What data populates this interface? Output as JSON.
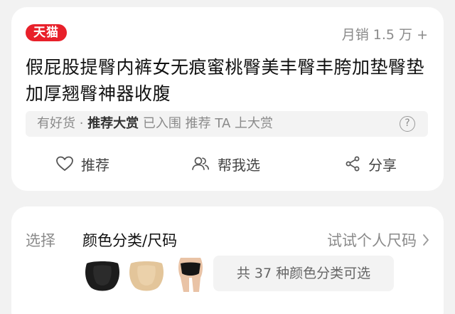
{
  "product": {
    "badge": "天猫",
    "sales": "月销 1.5 万 +",
    "title": "假屁股提臀内裤女无痕蜜桃臀美丰臀丰胯加垫臀垫加厚翘臀神器收腹",
    "award": {
      "prefix": "有好货 ·",
      "highlight": "推荐大赏",
      "suffix": "已入围 推荐 TA 上大赏",
      "help_glyph": "?"
    }
  },
  "actions": {
    "recommend": "推荐",
    "help_choose": "帮我选",
    "share": "分享"
  },
  "selection": {
    "label": "选择",
    "value": "颜色分类/尺码",
    "size_link": "试试个人尺码",
    "variants_button": "共 37 种颜色分类可选",
    "thumbnails": [
      "black-padded-panty",
      "nude-padded-panty",
      "black-panty-worn"
    ]
  },
  "colors": {
    "brand_red": "#e8202a",
    "muted_text": "#8a8a8a",
    "background": "#f2f2f2"
  }
}
